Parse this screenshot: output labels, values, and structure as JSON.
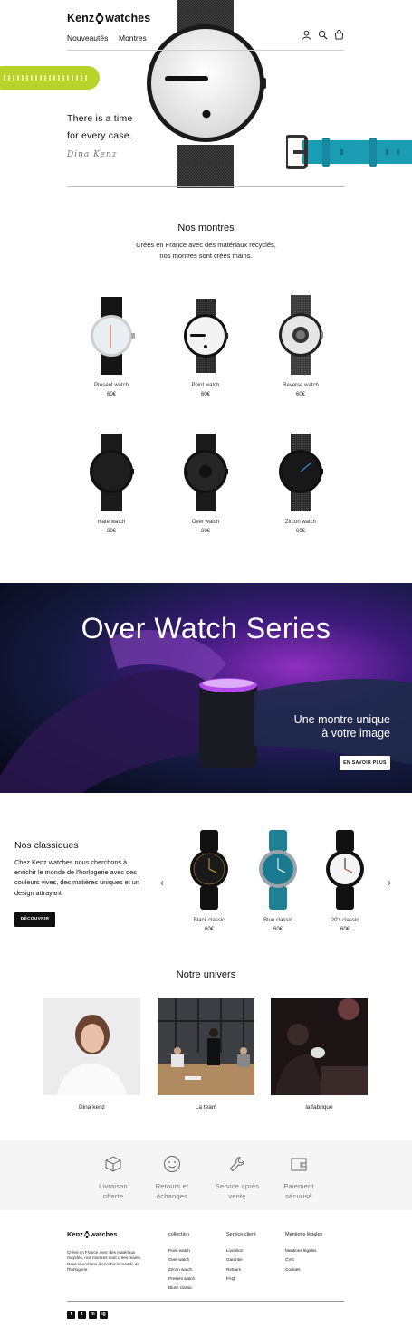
{
  "header": {
    "logo_left": "Kenz",
    "logo_right": "watches",
    "nav": [
      "Nouveautés",
      "Montres"
    ],
    "icons": [
      "user-icon",
      "search-icon",
      "cart-icon"
    ]
  },
  "hero": {
    "tagline_1": "There is a time",
    "tagline_2": "for every case.",
    "signature": "Dina Kenz"
  },
  "collection": {
    "title": "Nos montres",
    "subtitle_1": "Crées en France avec des matériaux recyclés,",
    "subtitle_2": "nos montres sont crées mains.",
    "products": [
      {
        "name": "Present watch",
        "price": "60€"
      },
      {
        "name": "Point watch",
        "price": "60€"
      },
      {
        "name": "Reverse watch",
        "price": "60€"
      },
      {
        "name": "mate watch",
        "price": "60€"
      },
      {
        "name": "Over watch",
        "price": "60€"
      },
      {
        "name": "Zircon watch",
        "price": "60€"
      }
    ]
  },
  "banner": {
    "title": "Over Watch Series",
    "sub_1": "Une montre unique",
    "sub_2": "à votre image",
    "button": "EN SAVOIR PLUS"
  },
  "classics": {
    "title": "Nos classiques",
    "text": "Chez Kenz watches nous cherchons à enrichir le monde de l'horlogerie avec des couleurs vives, des matières uniques et un design attrayant.",
    "button": "DÉCOUVRIR",
    "items": [
      {
        "name": "Black classic",
        "price": "60€"
      },
      {
        "name": "Blue classic",
        "price": "60€"
      },
      {
        "name": "20's classic",
        "price": "60€"
      }
    ]
  },
  "univers": {
    "title": "Notre univers",
    "cards": [
      "Dina kenz",
      "La team",
      "la fabrique"
    ]
  },
  "features": [
    {
      "l1": "Livraison",
      "l2": "offerte"
    },
    {
      "l1": "Retours et",
      "l2": "échanges"
    },
    {
      "l1": "Service après",
      "l2": "vente"
    },
    {
      "l1": "Paiement",
      "l2": "sécurisé"
    }
  ],
  "footer": {
    "logo_left": "Kenz",
    "logo_right": "watches",
    "about": "Crées en France avec des matériaux recyclés, nos montres sont crées mains. Nous cherchons à enrichir le monde de l'horlogerie.",
    "columns": [
      {
        "title": "collection",
        "items": [
          "Point watch",
          "Over watch",
          "Zircon watch",
          "Present watch",
          "Blush classic"
        ]
      },
      {
        "title": "Service client",
        "items": [
          "Livraison",
          "Garantie",
          "Retours",
          "FAQ"
        ]
      },
      {
        "title": "Mentions légales",
        "items": [
          "Mentions légales",
          "CVG",
          "Cookies"
        ]
      }
    ],
    "socials": [
      "f",
      "t",
      "in",
      "ig"
    ]
  },
  "colors": {
    "lime": "#b8d42a",
    "teal": "#1a9cb3",
    "dark": "#111111",
    "banner_purple": "#8f2fbf"
  }
}
